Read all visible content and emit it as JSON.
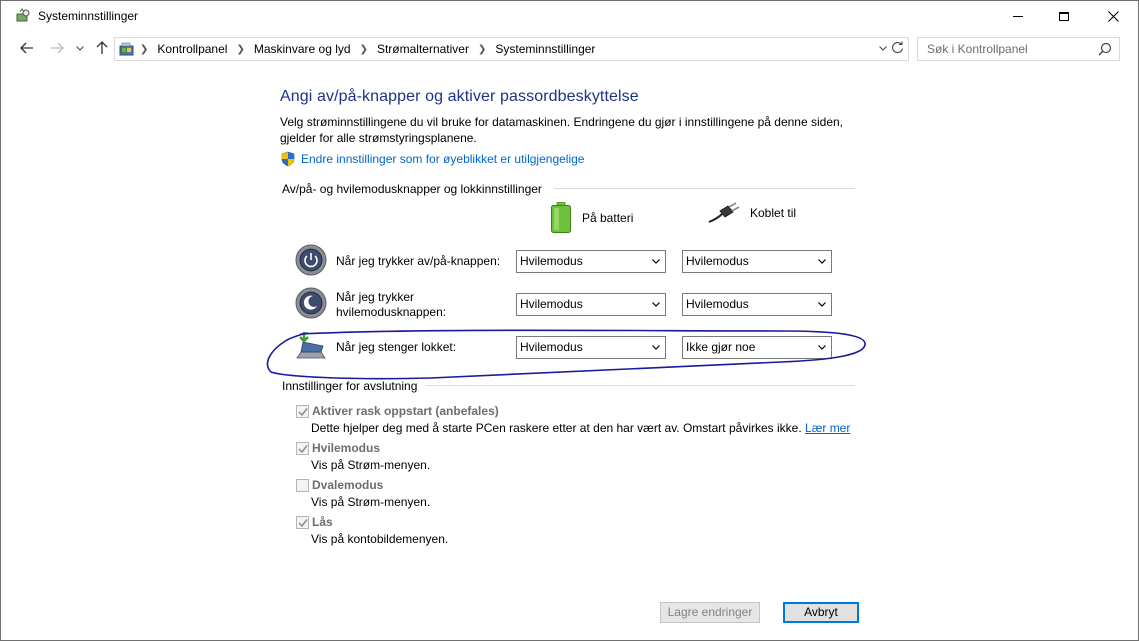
{
  "window": {
    "title": "Systeminnstillinger"
  },
  "address": {
    "breadcrumbs": [
      "Kontrollpanel",
      "Maskinvare og lyd",
      "Strømalternativer",
      "Systeminnstillinger"
    ],
    "search_placeholder": "Søk i Kontrollpanel"
  },
  "page": {
    "heading": "Angi av/på-knapper og aktiver passordbeskyttelse",
    "description": "Velg strøminnstillingene du vil bruke for datamaskinen. Endringene du gjør i innstillingene på denne siden, gjelder for alle strømstyringsplanene.",
    "change_settings_link": "Endre innstillinger som for øyeblikket er utilgjengelige"
  },
  "power_section": {
    "title": "Av/på- og hvilemodusknapper og lokkinnstillinger",
    "col_battery": "På batteri",
    "col_plugged": "Koblet til",
    "rows": [
      {
        "label": "Når jeg trykker av/på-knappen:",
        "battery": "Hvilemodus",
        "plugged": "Hvilemodus",
        "icon": "power-button-icon"
      },
      {
        "label": "Når jeg trykker hvilemodusknappen:",
        "label_line1": "Når jeg trykker",
        "label_line2": "hvilemodusknappen:",
        "battery": "Hvilemodus",
        "plugged": "Hvilemodus",
        "icon": "sleep-button-icon"
      },
      {
        "label": "Når jeg stenger lokket:",
        "battery": "Hvilemodus",
        "plugged": "Ikke gjør noe",
        "icon": "laptop-lid-icon"
      }
    ]
  },
  "shutdown_section": {
    "title": "Innstillinger for avslutning",
    "options": [
      {
        "label": "Aktiver rask oppstart (anbefales)",
        "checked": true,
        "description": "Dette hjelper deg med å starte PCen raskere etter at den har vært av. Omstart påvirkes ikke.",
        "link": "Lær mer"
      },
      {
        "label": "Hvilemodus",
        "checked": true,
        "description": "Vis på Strøm-menyen."
      },
      {
        "label": "Dvalemodus",
        "checked": false,
        "description": "Vis på Strøm-menyen."
      },
      {
        "label": "Lås",
        "checked": true,
        "description": "Vis på kontobildemenyen."
      }
    ]
  },
  "buttons": {
    "save": "Lagre endringer",
    "cancel": "Avbryt"
  },
  "colors": {
    "heading": "#1e3287",
    "link": "#0066cc",
    "annotation_ink": "#1a1a9c"
  }
}
